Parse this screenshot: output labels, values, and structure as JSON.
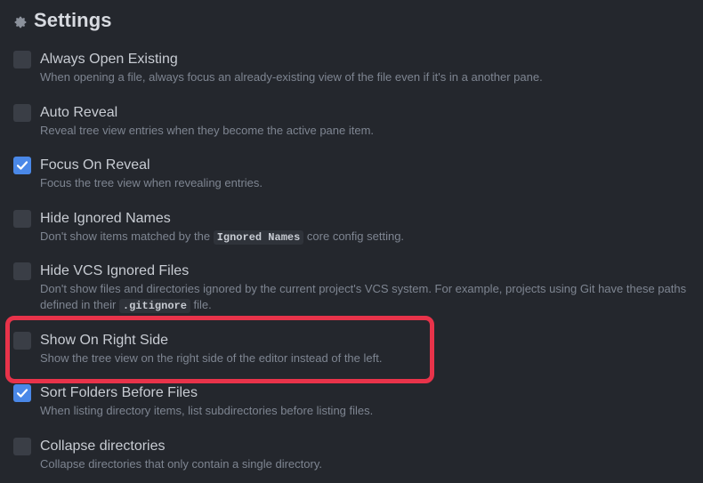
{
  "header": {
    "title": "Settings",
    "icon": "gear-icon"
  },
  "settings": [
    {
      "label": "Always Open Existing",
      "description": "When opening a file, always focus an already-existing view of the file even if it's in a another pane.",
      "checked": false
    },
    {
      "label": "Auto Reveal",
      "description": "Reveal tree view entries when they become the active pane item.",
      "checked": false
    },
    {
      "label": "Focus On Reveal",
      "description": "Focus the tree view when revealing entries.",
      "checked": true
    },
    {
      "label": "Hide Ignored Names",
      "description_before": "Don't show items matched by the ",
      "description_code": "Ignored Names",
      "description_after": " core config setting.",
      "checked": false
    },
    {
      "label": "Hide VCS Ignored Files",
      "description_before": "Don't show files and directories ignored by the current project's VCS system. For example, projects using Git have these paths defined in their ",
      "description_code": ".gitignore",
      "description_after": " file.",
      "checked": false
    },
    {
      "label": "Show On Right Side",
      "description": "Show the tree view on the right side of the editor instead of the left.",
      "checked": false
    },
    {
      "label": "Sort Folders Before Files",
      "description": "When listing directory items, list subdirectories before listing files.",
      "checked": true
    },
    {
      "label": "Collapse directories",
      "description": "Collapse directories that only contain a single directory.",
      "checked": false
    }
  ],
  "colors": {
    "background": "#24272d",
    "checkbox_checked": "#4a88e8",
    "checkbox_unchecked": "#3a3e46",
    "highlight": "#e8334a"
  }
}
